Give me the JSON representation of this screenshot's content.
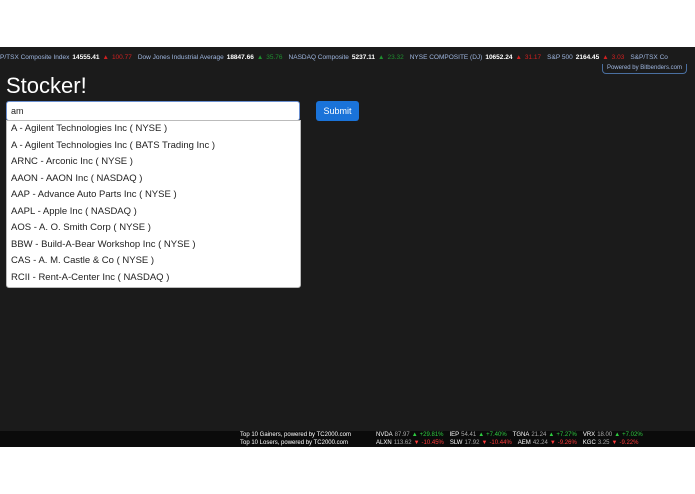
{
  "ticker": [
    {
      "name": "P/TSX Composite Index",
      "value": "14555.41",
      "arrow": "▲",
      "change": "100.77",
      "dir": "dn"
    },
    {
      "name": "Dow Jones Industrial Average",
      "value": "18847.66",
      "arrow": "▲",
      "change": "35.76",
      "dir": "up"
    },
    {
      "name": "NASDAQ Composite",
      "value": "5237.11",
      "arrow": "▲",
      "change": "23.32",
      "dir": "up"
    },
    {
      "name": "NYSE COMPOSITE (DJ)",
      "value": "10652.24",
      "arrow": "▲",
      "change": "31.17",
      "dir": "dn"
    },
    {
      "name": "S&P 500",
      "value": "2164.45",
      "arrow": "▲",
      "change": "3.03",
      "dir": "dn"
    },
    {
      "name": "S&P/TSX Co",
      "value": "",
      "arrow": "",
      "change": "",
      "dir": "dn"
    }
  ],
  "powered_by": "Powered by Bitbenders.com",
  "app_title": "Stocker!",
  "search": {
    "value": "am"
  },
  "submit_label": "Submit",
  "suggestions": [
    "A - Agilent Technologies Inc ( NYSE )",
    "A - Agilent Technologies Inc ( BATS Trading Inc )",
    "ARNC - Arconic Inc ( NYSE )",
    "AAON - AAON Inc ( NASDAQ )",
    "AAP - Advance Auto Parts Inc ( NYSE )",
    "AAPL - Apple Inc ( NASDAQ )",
    "AOS - A. O. Smith Corp ( NYSE )",
    "BBW - Build-A-Bear Workshop Inc ( NYSE )",
    "CAS - A. M. Castle & Co ( NYSE )",
    "RCII - Rent-A-Center Inc ( NASDAQ )"
  ],
  "gainers": {
    "label": "Top 10 Gainers, powered by TC2000.com",
    "items": [
      {
        "sym": "NVDA",
        "price": "87.97",
        "arrow": "▲",
        "pct": "+29.81%",
        "dir": "up"
      },
      {
        "sym": "IEP",
        "price": "54.41",
        "arrow": "▲",
        "pct": "+7.40%",
        "dir": "up"
      },
      {
        "sym": "TGNA",
        "price": "21.24",
        "arrow": "▲",
        "pct": "+7.27%",
        "dir": "up"
      },
      {
        "sym": "VRX",
        "price": "18.00",
        "arrow": "▲",
        "pct": "+7.02%",
        "dir": "up"
      }
    ]
  },
  "losers": {
    "label": "Top 10 Losers, powered by TC2000.com",
    "items": [
      {
        "sym": "ALXN",
        "price": "113.62",
        "arrow": "▼",
        "pct": "-10.45%",
        "dir": "dn"
      },
      {
        "sym": "SLW",
        "price": "17.92",
        "arrow": "▼",
        "pct": "-10.44%",
        "dir": "dn"
      },
      {
        "sym": "AEM",
        "price": "42.24",
        "arrow": "▼",
        "pct": "-9.26%",
        "dir": "dn"
      },
      {
        "sym": "KGC",
        "price": "3.25",
        "arrow": "▼",
        "pct": "-9.22%",
        "dir": "dn"
      }
    ]
  },
  "colors": {
    "accent": "#1a73d9",
    "background": "#1b1b1b",
    "up": "#2ecc40",
    "down": "#ff3b3b"
  }
}
